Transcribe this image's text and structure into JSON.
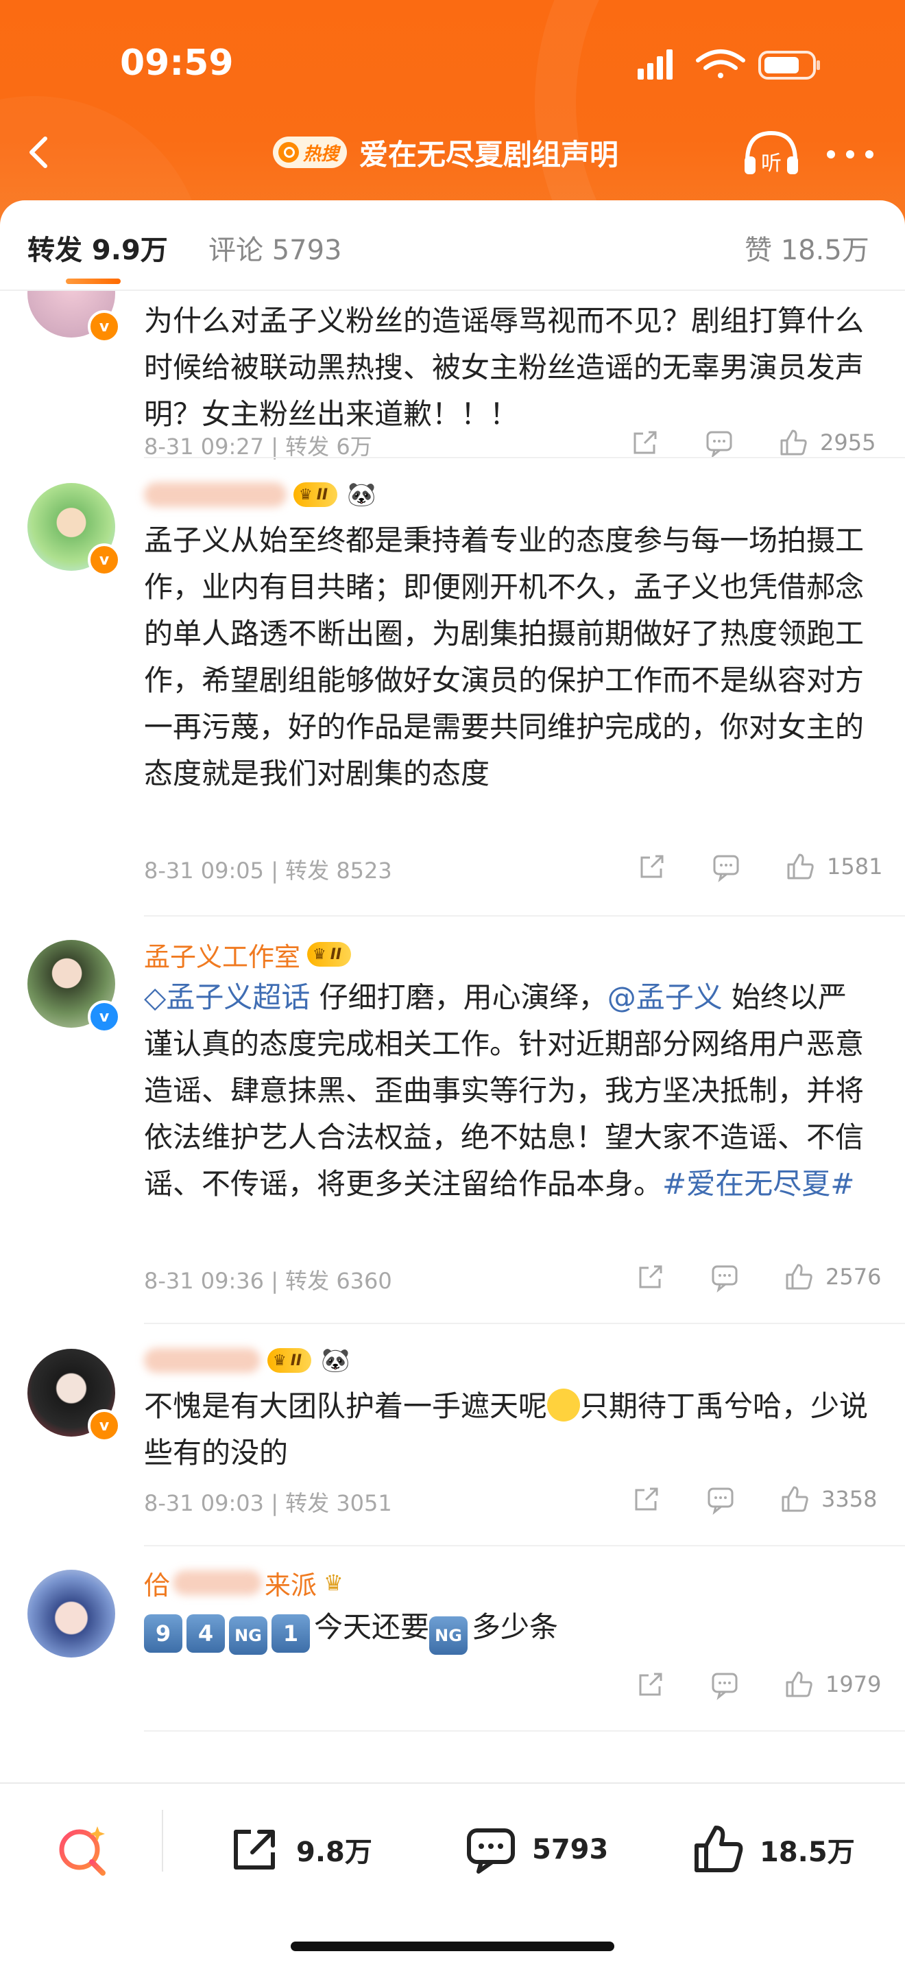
{
  "status_bar": {
    "time": "09:59"
  },
  "nav": {
    "hot_badge": "热搜",
    "title": "爱在无尽夏剧组声明",
    "listen_label": "听"
  },
  "tabs": {
    "repost": "转发 9.9万",
    "comment": "评论 5793",
    "like": "赞 18.5万"
  },
  "comments": [
    {
      "text": "为什么对孟子义粉丝的造谣辱骂视而不见？剧组打算什么时候给被联动黑热搜、被女主粉丝造谣的无辜男演员发声明？女主粉丝出来道歉！！！",
      "meta": "8-31 09:27 | 转发 6万",
      "likes": "2955"
    },
    {
      "name_visible": "",
      "level": "II",
      "text": "孟子义从始至终都是秉持着专业的态度参与每一场拍摄工作，业内有目共睹；即便刚开机不久，孟子义也凭借郝念的单人路透不断出圈，为剧集拍摄前期做好了热度领跑工作，希望剧组能够做好女演员的保护工作而不是纵容对方一再污蔑，好的作品是需要共同维护完成的，你对女主的态度就是我们对剧集的态度",
      "meta": "8-31 09:05 | 转发 8523",
      "likes": "1581"
    },
    {
      "name": "孟子义工作室",
      "level": "II",
      "text_pre": "",
      "super_topic": "孟子义超话",
      "text_1": " 仔细打磨，用心演绎，",
      "mention": "@孟子义",
      "text_2": " 始终以严谨认真的态度完成相关工作。针对近期部分网络用户恶意造谣、肆意抹黑、歪曲事实等行为，我方坚决抵制，并将依法维护艺人合法权益，绝不姑息！望大家不造谣、不信谣、不传谣，将更多关注留给作品本身。",
      "hashtag": "#爱在无尽夏#",
      "meta": "8-31 09:36 | 转发 6360",
      "likes": "2576"
    },
    {
      "level": "II",
      "text_1": "不愧是有大团队护着一手遮天呢",
      "text_2": "只期待丁禹兮哈，少说些有的没的",
      "meta": "8-31 09:03 | 转发 3051",
      "likes": "3358"
    },
    {
      "name_start": "佮",
      "name_end": "来派",
      "keys": [
        "9",
        "4",
        "NG",
        "1"
      ],
      "text_1": "今天还要",
      "key_mid": "NG",
      "text_2": "多少条",
      "likes": "1979"
    }
  ],
  "bottom_bar": {
    "repost": "9.8万",
    "comment": "5793",
    "like": "18.5万"
  },
  "colors": {
    "brand_orange": "#fa6d15",
    "link_blue": "#3f6db3",
    "name_orange": "#f07a20"
  },
  "icons": [
    "back-icon",
    "hot-search-icon",
    "listen-icon",
    "more-icon",
    "share-icon",
    "comment-icon",
    "like-icon",
    "search-icon",
    "verified-badge",
    "level-crown-icon",
    "panda-emoji"
  ]
}
